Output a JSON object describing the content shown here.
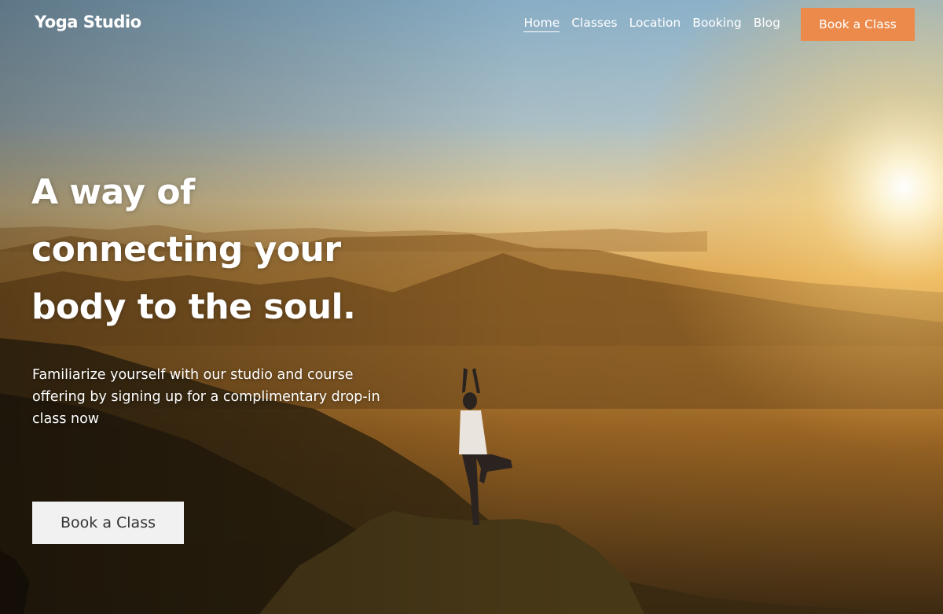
{
  "brand": {
    "name": "Yoga Studio"
  },
  "nav": {
    "links": [
      {
        "label": "Home",
        "active": true
      },
      {
        "label": "Classes",
        "active": false
      },
      {
        "label": "Location",
        "active": false
      },
      {
        "label": "Booking",
        "active": false
      },
      {
        "label": "Blog",
        "active": false
      }
    ],
    "cta_label": "Book a Class"
  },
  "hero": {
    "headline_lines": [
      "A way of",
      "connecting your",
      "body to the soul."
    ],
    "subtext": "Familiarize yourself with our studio and course offering by signing up for a complimentary drop-in class now",
    "cta_label": "Book a Class"
  },
  "colors": {
    "accent": "#ec8a4b",
    "cta_light": "#f1f1f1",
    "sky_top": "#8fb6cf",
    "sun_glow": "#f6c36a"
  }
}
